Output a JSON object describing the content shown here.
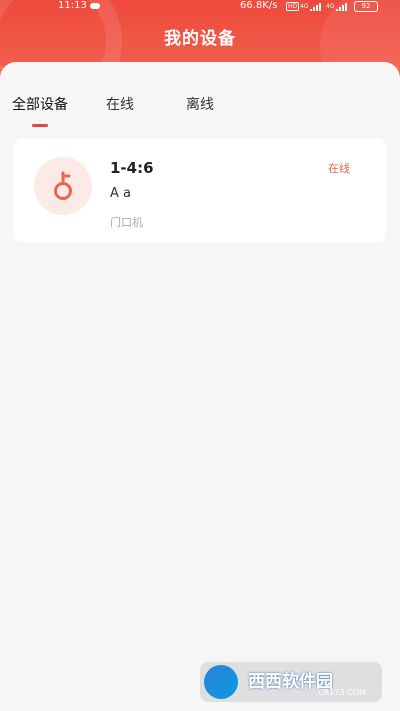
{
  "status_bar": {
    "time": "11:13",
    "speed": "66.8K/s",
    "hd": "HD",
    "net1": "4G",
    "net2": "4G",
    "battery": "92"
  },
  "header": {
    "title": "我的设备"
  },
  "tabs": [
    {
      "label": "全部设备",
      "active": true
    },
    {
      "label": "在线",
      "active": false
    },
    {
      "label": "离线",
      "active": false
    }
  ],
  "devices": [
    {
      "name": "1-4:6",
      "subtitle": "A a",
      "type": "门口机",
      "status": "在线",
      "icon": "key-icon"
    }
  ],
  "watermark": {
    "text": "西西软件园",
    "url": "CR173.COM"
  },
  "colors": {
    "accent": "#ee4a3d",
    "status_online": "#e8674f",
    "avatar_bg": "#fde9e6"
  }
}
